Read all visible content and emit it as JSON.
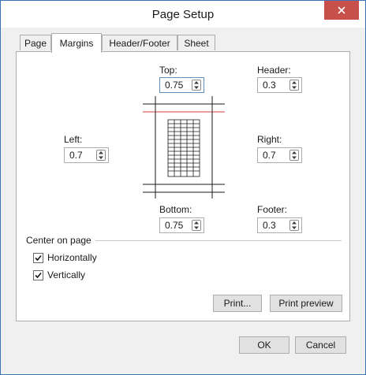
{
  "window": {
    "title": "Page Setup"
  },
  "tabs": [
    {
      "label": "Page"
    },
    {
      "label": "Margins"
    },
    {
      "label": "Header/Footer"
    },
    {
      "label": "Sheet"
    }
  ],
  "margins": {
    "top": {
      "label": "Top:",
      "value": "0.75"
    },
    "header": {
      "label": "Header:",
      "value": "0.3"
    },
    "left": {
      "label": "Left:",
      "value": "0.7"
    },
    "right": {
      "label": "Right:",
      "value": "0.7"
    },
    "bottom": {
      "label": "Bottom:",
      "value": "0.75"
    },
    "footer": {
      "label": "Footer:",
      "value": "0.3"
    }
  },
  "center_on_page": {
    "label": "Center on page",
    "horizontally": {
      "label": "Horizontally",
      "checked": true
    },
    "vertically": {
      "label": "Vertically",
      "checked": true
    }
  },
  "buttons": {
    "print": "Print...",
    "print_preview": "Print preview",
    "ok": "OK",
    "cancel": "Cancel"
  },
  "colors": {
    "accent_border": "#3a74b8",
    "close_button": "#c7504a",
    "margin_line": "#d04040"
  }
}
